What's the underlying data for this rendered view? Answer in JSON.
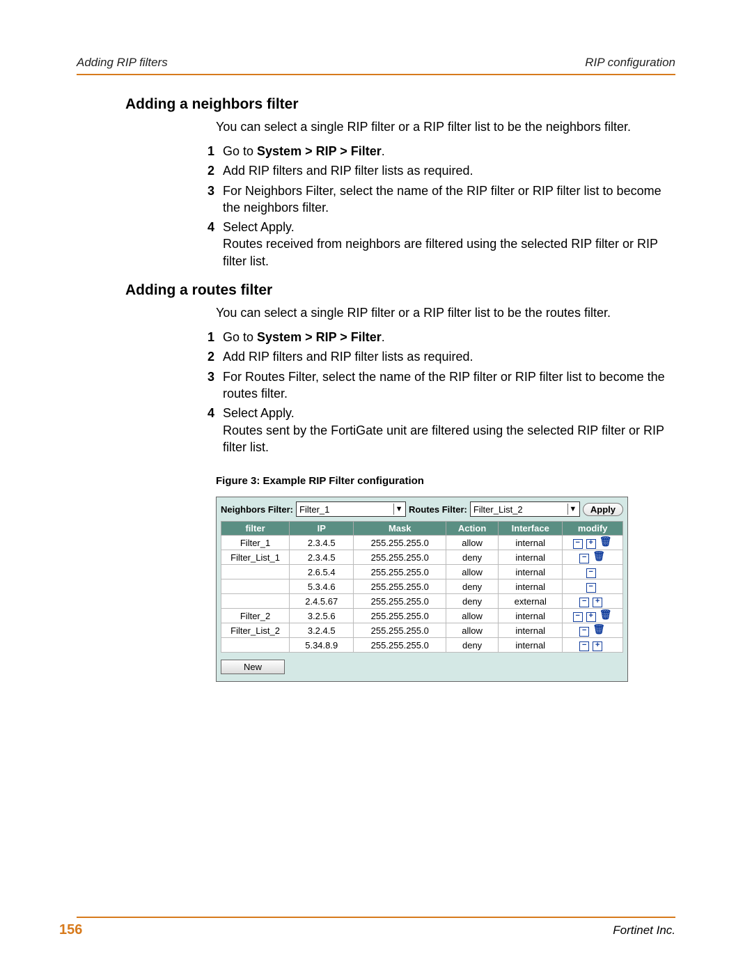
{
  "header": {
    "left": "Adding RIP filters",
    "right": "RIP configuration"
  },
  "section1": {
    "title": "Adding a neighbors filter",
    "intro": "You can select a single RIP filter or a RIP filter list to be the neighbors filter.",
    "steps": {
      "1": {
        "prefix": "Go to ",
        "bold": "System > RIP > Filter",
        "suffix": "."
      },
      "2": {
        "text": "Add RIP filters and RIP filter lists as required."
      },
      "3": {
        "text": "For Neighbors Filter, select the name of the RIP filter or RIP filter list to become the neighbors filter."
      },
      "4": {
        "text": "Select Apply.",
        "note": "Routes received from neighbors are filtered using the selected RIP filter or RIP filter list."
      }
    }
  },
  "section2": {
    "title": "Adding a routes filter",
    "intro": "You can select a single RIP filter or a RIP filter list to be the routes filter.",
    "steps": {
      "1": {
        "prefix": "Go to ",
        "bold": "System > RIP > Filter",
        "suffix": "."
      },
      "2": {
        "text": "Add RIP filters and RIP filter lists as required."
      },
      "3": {
        "text": "For Routes Filter, select the name of the RIP filter or RIP filter list to become the routes filter."
      },
      "4": {
        "text": "Select Apply.",
        "note": "Routes sent by the FortiGate unit are filtered using the selected RIP filter or RIP filter list."
      }
    }
  },
  "figure": {
    "caption": "Figure 3:   Example RIP Filter configuration"
  },
  "screenshot": {
    "neighbors_label": "Neighbors Filter:",
    "neighbors_value": "Filter_1",
    "routes_label": "Routes Filter:",
    "routes_value": "Filter_List_2",
    "apply_label": "Apply",
    "headers": {
      "filter": "filter",
      "ip": "IP",
      "mask": "Mask",
      "action": "Action",
      "interface": "Interface",
      "modify": "modify"
    },
    "rows": [
      {
        "filter": "Filter_1",
        "ip": "2.3.4.5",
        "mask": "255.255.255.0",
        "action": "allow",
        "interface": "internal",
        "icons": [
          "minus",
          "plus",
          "trash"
        ]
      },
      {
        "filter": "Filter_List_1",
        "ip": "2.3.4.5",
        "mask": "255.255.255.0",
        "action": "deny",
        "interface": "internal",
        "icons": [
          "minus",
          "trash"
        ]
      },
      {
        "filter": "",
        "ip": "2.6.5.4",
        "mask": "255.255.255.0",
        "action": "allow",
        "interface": "internal",
        "icons": [
          "minus"
        ]
      },
      {
        "filter": "",
        "ip": "5.3.4.6",
        "mask": "255.255.255.0",
        "action": "deny",
        "interface": "internal",
        "icons": [
          "minus"
        ]
      },
      {
        "filter": "",
        "ip": "2.4.5.67",
        "mask": "255.255.255.0",
        "action": "deny",
        "interface": "external",
        "icons": [
          "minus",
          "plus"
        ]
      },
      {
        "filter": "Filter_2",
        "ip": "3.2.5.6",
        "mask": "255.255.255.0",
        "action": "allow",
        "interface": "internal",
        "icons": [
          "minus",
          "plus",
          "trash"
        ]
      },
      {
        "filter": "Filter_List_2",
        "ip": "3.2.4.5",
        "mask": "255.255.255.0",
        "action": "allow",
        "interface": "internal",
        "icons": [
          "minus",
          "trash"
        ]
      },
      {
        "filter": "",
        "ip": "5.34.8.9",
        "mask": "255.255.255.0",
        "action": "deny",
        "interface": "internal",
        "icons": [
          "minus",
          "plus"
        ]
      }
    ],
    "new_label": "New"
  },
  "footer": {
    "page": "156",
    "right": "Fortinet Inc."
  }
}
